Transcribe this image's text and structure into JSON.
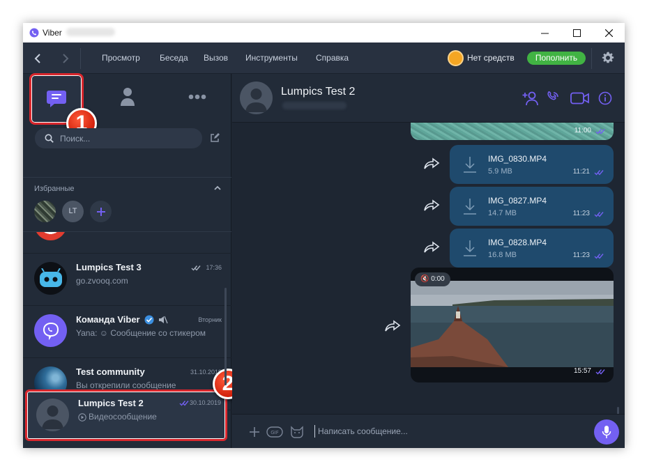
{
  "window": {
    "title": "Viber"
  },
  "menu": {
    "items": [
      "Просмотр",
      "Беседа",
      "Вызов",
      "Инструменты",
      "Справка"
    ]
  },
  "balance": {
    "text": "Нет средств",
    "topup_label": "Пополнить"
  },
  "search": {
    "placeholder": "Поиск..."
  },
  "favorites": {
    "label": "Избранные",
    "initials": "LT"
  },
  "chats": [
    {
      "name": "Lumpics Test 3",
      "subtitle": "go.zvooq.com",
      "time": "17:36"
    },
    {
      "name": "Команда Viber",
      "subtitle": "Yana: ☺ Сообщение со стикером",
      "time": "Вторник"
    },
    {
      "name": "Test community",
      "subtitle": "Вы открепили сообщение",
      "time": "31.10.2019"
    },
    {
      "name": "Lumpics Test 2",
      "subtitle": "Видеосообщение",
      "time": "30.10.2019"
    }
  ],
  "conversation": {
    "name": "Lumpics Test 2",
    "top_time": "11:00",
    "files": [
      {
        "name": "IMG_0830.MP4",
        "size": "5.9 MB",
        "time": "11:21"
      },
      {
        "name": "IMG_0827.MP4",
        "size": "14.7 MB",
        "time": "11:23"
      },
      {
        "name": "IMG_0828.MP4",
        "size": "16.8 MB",
        "time": "11:23"
      }
    ],
    "video": {
      "duration": "0:00",
      "time": "15:57"
    }
  },
  "composer": {
    "placeholder": "Написать сообщение..."
  },
  "annotations": {
    "step1": "1",
    "step2": "2"
  },
  "colors": {
    "accent": "#7360f2",
    "topup": "#41b343",
    "highlight": "#d9262c",
    "bubble": "#1f4a6d"
  }
}
